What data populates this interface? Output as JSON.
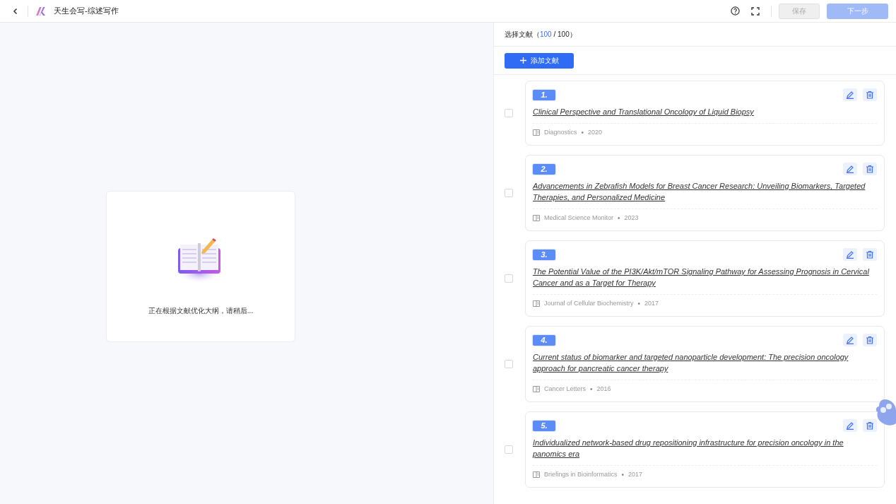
{
  "header": {
    "title": "天生会写-综述写作",
    "save_button": {
      "label": "保存",
      "disabled": true
    },
    "next_button": {
      "label": "下一步",
      "disabled": true
    }
  },
  "loading": {
    "message": "正在根据文献优化大纲，请稍后..."
  },
  "references_panel": {
    "title": "选择文献（",
    "selected_count": "100",
    "total_count": "/ 100）",
    "add_button": "添加文献",
    "items": [
      {
        "number": "1.",
        "title": "Clinical Perspective and Translational Oncology of Liquid Biopsy",
        "journal": "Diagnostics",
        "separator": "•",
        "year": "2020",
        "checked": false
      },
      {
        "number": "2.",
        "title": "Advancements in Zebrafish Models for Breast Cancer Research: Unveiling Biomarkers, Targeted Therapies, and Personalized Medicine",
        "journal": "Medical Science Monitor",
        "separator": "•",
        "year": "2023",
        "checked": false
      },
      {
        "number": "3.",
        "title": "The Potential Value of the PI3K/Akt/mTOR Signaling Pathway for Assessing Prognosis in Cervical Cancer and as a Target for Therapy",
        "journal": "Journal of Cellular Biochemistry",
        "separator": "•",
        "year": "2017",
        "checked": false
      },
      {
        "number": "4.",
        "title": "Current status of biomarker and targeted nanoparticle development: The precision oncology approach for pancreatic cancer therapy",
        "journal": "Cancer Letters",
        "separator": "•",
        "year": "2016",
        "checked": false
      },
      {
        "number": "5.",
        "title": "Individualized network-based drug repositioning infrastructure for precision oncology in the panomics era",
        "journal": "Briefings in Bioinformatics",
        "separator": "•",
        "year": "2017",
        "checked": false
      }
    ]
  }
}
